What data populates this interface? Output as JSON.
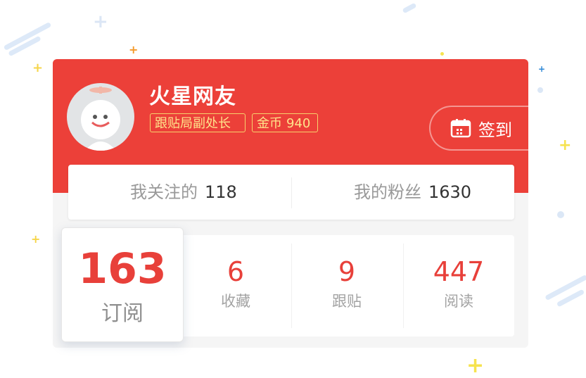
{
  "profile": {
    "username": "火星网友",
    "title_badge": "跟贴局副处长",
    "coin_label": "金币",
    "coin_value": "940",
    "checkin_label": "签到"
  },
  "follow": {
    "following_label": "我关注的",
    "following_count": "118",
    "fans_label": "我的粉丝",
    "fans_count": "1630"
  },
  "stats": {
    "subscribe": {
      "value": "163",
      "label": "订阅"
    },
    "favorites": {
      "value": "6",
      "label": "收藏"
    },
    "comments": {
      "value": "9",
      "label": "跟贴"
    },
    "reads": {
      "value": "447",
      "label": "阅读"
    }
  },
  "colors": {
    "header_red": "#ec4039",
    "accent_red": "#e8403a",
    "badge_gold": "#f7d26c"
  },
  "icons": [
    "avatar",
    "calendar-icon"
  ]
}
